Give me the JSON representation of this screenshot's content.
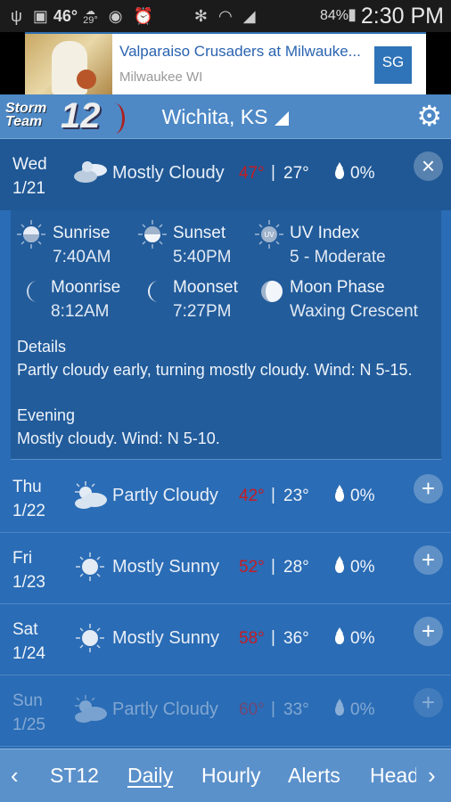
{
  "status_bar": {
    "temp": "46°",
    "weather_temp": "29°",
    "battery": "84%",
    "time": "2:30 PM"
  },
  "ad": {
    "title": "Valparaiso Crusaders at Milwauke...",
    "subtitle": "Milwaukee WI",
    "logo": "SG"
  },
  "header": {
    "brand": "Storm Team 12",
    "location": "Wichita, KS"
  },
  "expanded": {
    "day": "Wed",
    "date": "1/21",
    "condition": "Mostly Cloudy",
    "icon": "mostly-cloudy-icon",
    "high": "47°",
    "low": "27°",
    "precip": "0%",
    "sunrise_label": "Sunrise",
    "sunrise": "7:40AM",
    "sunset_label": "Sunset",
    "sunset": "5:40PM",
    "uv_label": "UV Index",
    "uv": "5 - Moderate",
    "moonrise_label": "Moonrise",
    "moonrise": "8:12AM",
    "moonset_label": "Moonset",
    "moonset": "7:27PM",
    "phase_label": "Moon Phase",
    "phase": "Waxing Crescent",
    "details_label": "Details",
    "details": "Partly cloudy early, turning mostly cloudy.  Wind:  N 5-15.",
    "evening_label": "Evening",
    "evening": "Mostly cloudy.  Wind: N 5-10."
  },
  "days": [
    {
      "day": "Thu",
      "date": "1/22",
      "condition": "Partly Cloudy",
      "icon": "partly-cloudy-icon",
      "high": "42°",
      "low": "23°",
      "precip": "0%"
    },
    {
      "day": "Fri",
      "date": "1/23",
      "condition": "Mostly Sunny",
      "icon": "sunny-icon",
      "high": "52°",
      "low": "28°",
      "precip": "0%"
    },
    {
      "day": "Sat",
      "date": "1/24",
      "condition": "Mostly Sunny",
      "icon": "sunny-icon",
      "high": "58°",
      "low": "36°",
      "precip": "0%"
    },
    {
      "day": "Sun",
      "date": "1/25",
      "condition": "Partly Cloudy",
      "icon": "partly-cloudy-icon",
      "high": "60°",
      "low": "33°",
      "precip": "0%"
    }
  ],
  "nav": {
    "tabs": [
      "ST12",
      "Daily",
      "Hourly",
      "Alerts",
      "Head"
    ],
    "active": "Daily"
  },
  "colors": {
    "high_temp": "#c41d26",
    "header": "#4e89c6",
    "expanded_row": "#1f5895",
    "list": "#2a6cb5"
  }
}
